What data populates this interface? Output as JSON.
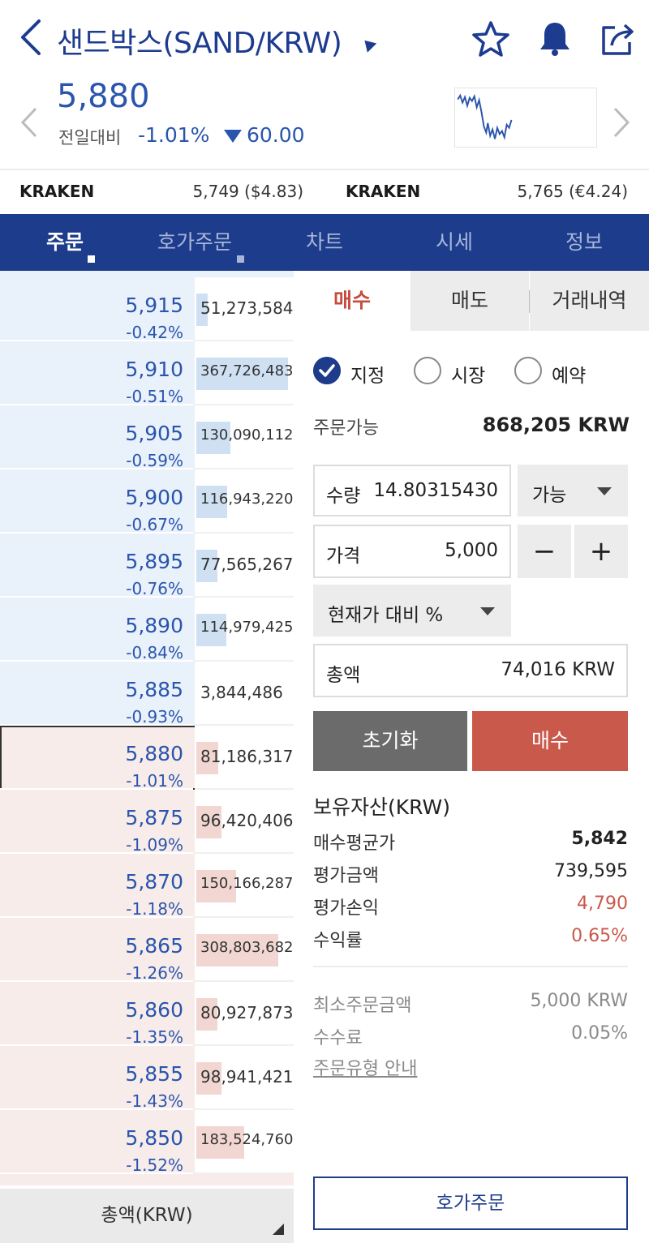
{
  "header": {
    "title": "샌드박스(SAND/KRW)",
    "price": "5,880",
    "change_label": "전일대비",
    "change_rate": "-1.01%",
    "change_abs": "60.00",
    "down_color": "#2a55ad"
  },
  "exchanges": [
    {
      "name": "KRAKEN",
      "value": "5,749 ($4.83)"
    },
    {
      "name": "KRAKEN",
      "value": "5,765 (€4.24)"
    }
  ],
  "tabs": [
    "주문",
    "호가주문",
    "차트",
    "시세",
    "정보"
  ],
  "active_tab": 0,
  "orderbook": {
    "rows": [
      {
        "price": "5,915",
        "rate": "-0.42%",
        "volume": "51,273,584",
        "side": "sell",
        "bar_fraction": 0.12
      },
      {
        "price": "5,910",
        "rate": "-0.51%",
        "volume": "367,726,483",
        "side": "sell",
        "bar_fraction": 0.97
      },
      {
        "price": "5,905",
        "rate": "-0.59%",
        "volume": "130,090,112",
        "side": "sell",
        "bar_fraction": 0.36
      },
      {
        "price": "5,900",
        "rate": "-0.67%",
        "volume": "116,943,220",
        "side": "sell",
        "bar_fraction": 0.33
      },
      {
        "price": "5,895",
        "rate": "-0.76%",
        "volume": "77,565,267",
        "side": "sell",
        "bar_fraction": 0.22
      },
      {
        "price": "5,890",
        "rate": "-0.84%",
        "volume": "114,979,425",
        "side": "sell",
        "bar_fraction": 0.32
      },
      {
        "price": "5,885",
        "rate": "-0.93%",
        "volume": "3,844,486",
        "side": "sell",
        "bar_fraction": 0.0
      },
      {
        "price": "5,880",
        "rate": "-1.01%",
        "volume": "81,186,317",
        "side": "buy",
        "bar_fraction": 0.23,
        "current": true
      },
      {
        "price": "5,875",
        "rate": "-1.09%",
        "volume": "96,420,406",
        "side": "buy",
        "bar_fraction": 0.27
      },
      {
        "price": "5,870",
        "rate": "-1.18%",
        "volume": "150,166,287",
        "side": "buy",
        "bar_fraction": 0.42
      },
      {
        "price": "5,865",
        "rate": "-1.26%",
        "volume": "308,803,682",
        "side": "buy",
        "bar_fraction": 0.87
      },
      {
        "price": "5,860",
        "rate": "-1.35%",
        "volume": "80,927,873",
        "side": "buy",
        "bar_fraction": 0.22
      },
      {
        "price": "5,855",
        "rate": "-1.43%",
        "volume": "98,941,421",
        "side": "buy",
        "bar_fraction": 0.27
      },
      {
        "price": "5,850",
        "rate": "-1.52%",
        "volume": "183,524,760",
        "side": "buy",
        "bar_fraction": 0.51
      }
    ],
    "footer_label": "총액(KRW)"
  },
  "order": {
    "tabs": [
      "매수",
      "매도",
      "거래내역"
    ],
    "order_types": [
      "지정",
      "시장",
      "예약"
    ],
    "selected_type": 0,
    "available_label": "주문가능",
    "available_value": "868,205 KRW",
    "quantity_label": "수량",
    "quantity_value": "14.80315430",
    "quantity_dropdown": "가능",
    "price_label": "가격",
    "price_value": "5,000",
    "minus": "−",
    "plus": "+",
    "percent_dropdown": "현재가 대비 %",
    "total_label": "총액",
    "total_value": "74,016 KRW",
    "reset_label": "초기화",
    "buy_label": "매수",
    "buy_color": "#c9594b"
  },
  "holdings": {
    "title": "보유자산(KRW)",
    "items": [
      {
        "label": "매수평균가",
        "value": "5,842"
      },
      {
        "label": "평가금액",
        "value": "739,595"
      },
      {
        "label": "평가손익",
        "value": "4,790"
      },
      {
        "label": "수익률",
        "value": "0.65%"
      }
    ],
    "min_order_label": "최소주문금액",
    "min_order_value": "5,000 KRW",
    "fee_label": "수수료",
    "fee_value": "0.05%",
    "guide_label": "주문유형 안내"
  },
  "bottom_button": "호가주문",
  "icons": [
    "back-icon",
    "star-icon",
    "bell-icon",
    "share-icon",
    "chevron-left-icon",
    "chevron-right-icon",
    "sparkline-icon",
    "check-icon"
  ]
}
